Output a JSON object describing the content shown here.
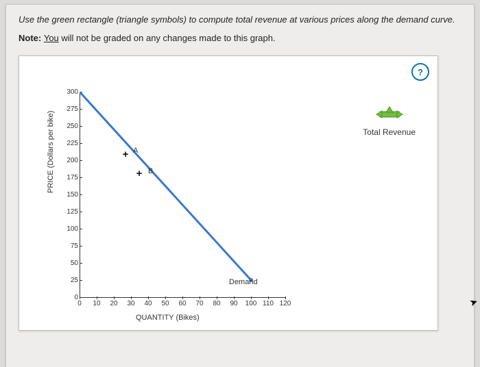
{
  "instruction": "Use the green rectangle (triangle symbols) to compute total revenue at various prices along the demand curve.",
  "note_prefix": "Note: ",
  "note_body_1": "You",
  "note_body_2": " will not be graded on any changes made to this graph.",
  "help_label": "?",
  "legend": {
    "label": "Total Revenue"
  },
  "ylabel": "PRICE (Dollars per bike)",
  "xlabel": "QUANTITY (Bikes)",
  "points": {
    "A": {
      "label": "A"
    },
    "B": {
      "label": "B"
    }
  },
  "demand_label": "Demand",
  "chart_data": {
    "type": "line",
    "title": "",
    "xlabel": "QUANTITY (Bikes)",
    "ylabel": "PRICE (Dollars per bike)",
    "xlim": [
      0,
      120
    ],
    "ylim": [
      0,
      300
    ],
    "x_ticks": [
      0,
      10,
      20,
      30,
      40,
      50,
      60,
      70,
      80,
      90,
      100,
      110,
      120
    ],
    "y_ticks": [
      0,
      25,
      50,
      75,
      100,
      125,
      150,
      175,
      200,
      225,
      250,
      275,
      300
    ],
    "series": [
      {
        "name": "Demand",
        "x": [
          0,
          100
        ],
        "y": [
          300,
          25
        ],
        "color": "#3a78c9"
      }
    ],
    "markers": [
      {
        "name": "A",
        "x": 27,
        "y": 208
      },
      {
        "name": "B",
        "x": 35,
        "y": 180
      }
    ],
    "legend": {
      "items": [
        "Total Revenue"
      ],
      "position": "right"
    }
  }
}
